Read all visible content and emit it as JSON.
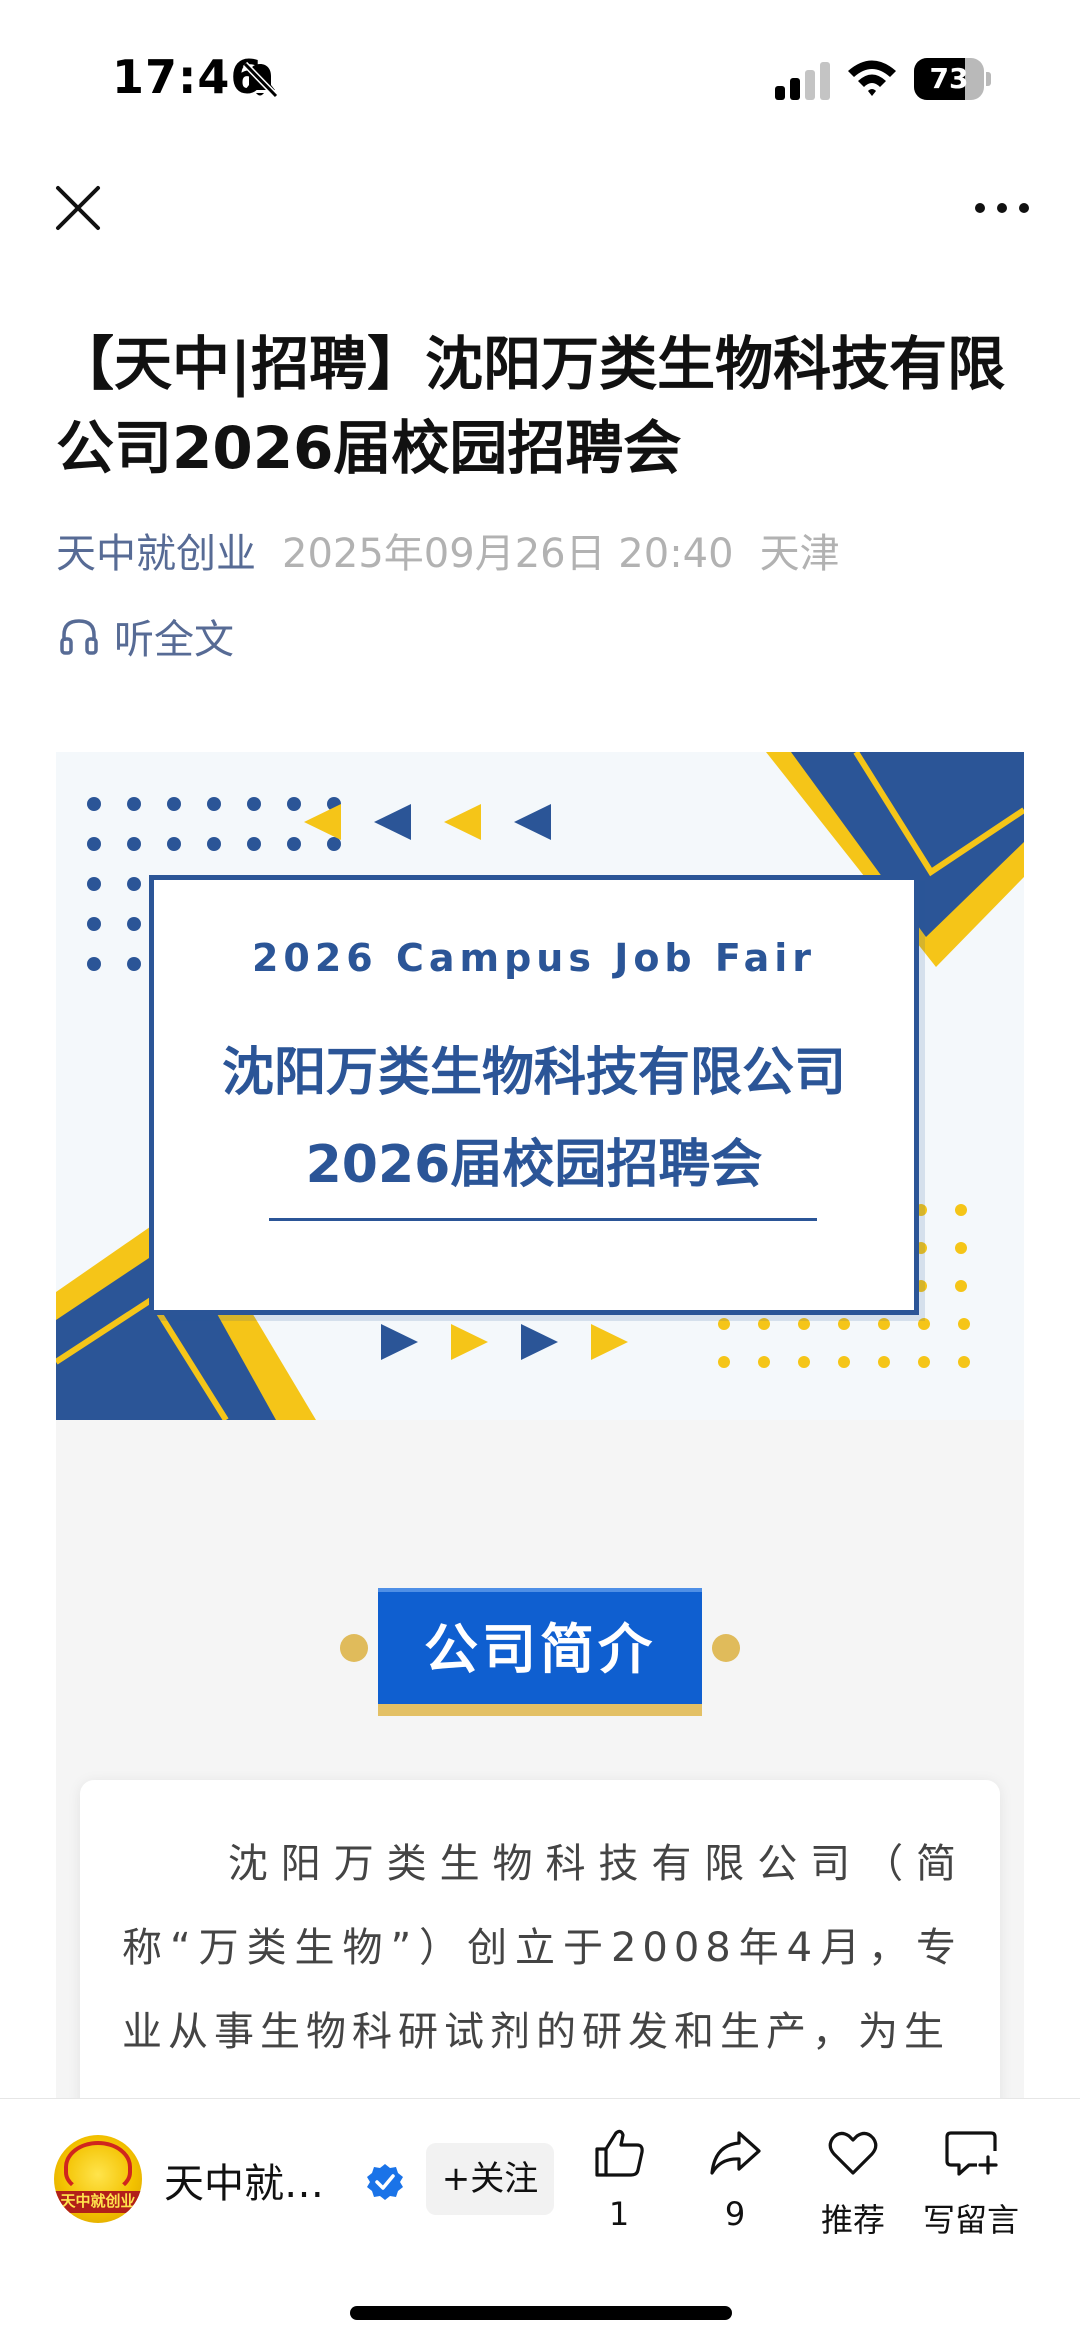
{
  "status_bar": {
    "time": "17:46",
    "battery": "73",
    "battery_level": 0.73,
    "icons": [
      "bell-slash-icon",
      "signal-icon",
      "wifi-icon",
      "battery-icon"
    ]
  },
  "nav": {
    "close_icon": "close-icon",
    "more_icon": "more-dots-icon"
  },
  "article": {
    "title": "【天中|招聘】沈阳万类生物科技有限公司2026届校园招聘会",
    "author": "天中就创业",
    "date": "2025年09月26日 20:40",
    "location": "天津",
    "listen_label": "听全文"
  },
  "banner": {
    "english": "2026 Campus Job Fair",
    "line1": "沈阳万类生物科技有限公司",
    "line2": "2026届校园招聘会",
    "colors": {
      "navy": "#2b5597",
      "yellow": "#f5c518"
    }
  },
  "section": {
    "title": "公司简介",
    "paragraph": "　　沈阳万类生物科技有限公司（简称“万类生物”）创立于2008年4月，专业从事生物科研试剂的研发和生产，为生"
  },
  "bottom_bar": {
    "account_name": "天中就创业",
    "avatar_text": "天中就创业",
    "follow_label": "+关注",
    "like_count": "1",
    "share_count": "9",
    "recommend_label": "推荐",
    "comment_label": "写留言"
  }
}
